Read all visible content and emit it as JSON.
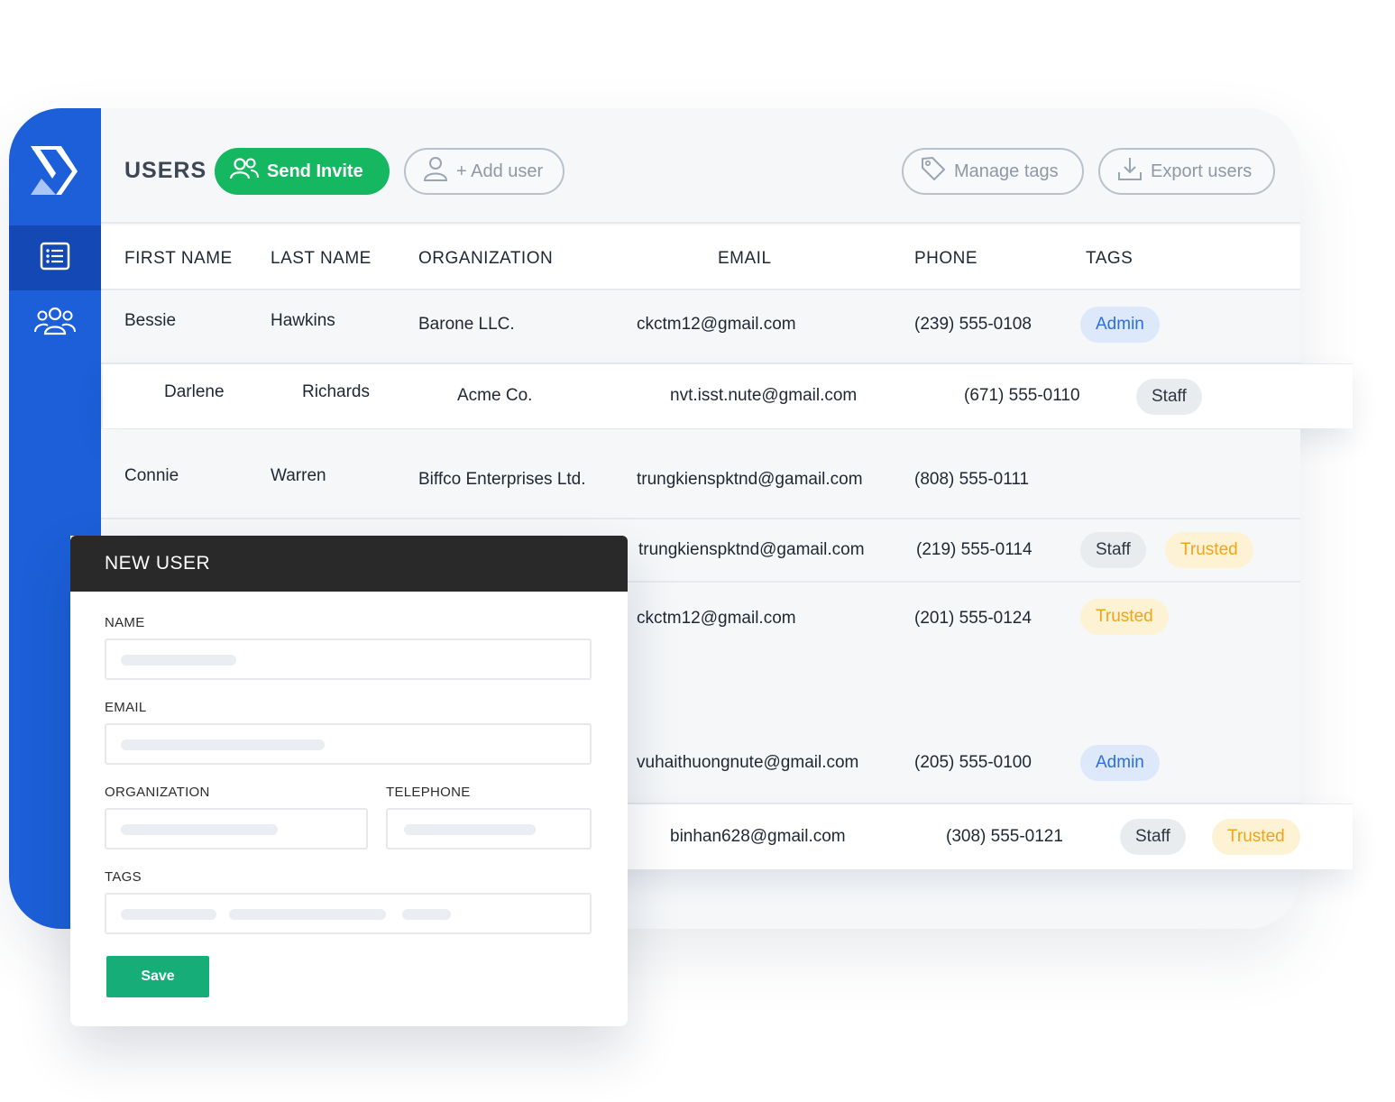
{
  "toolbar": {
    "title": "USERS",
    "send_invite": "Send Invite",
    "add_user": "+ Add user",
    "manage_tags": "Manage tags",
    "export_users": "Export users"
  },
  "table": {
    "columns": [
      "FIRST NAME",
      "LAST NAME",
      "ORGANIZATION",
      "EMAIL",
      "PHONE",
      "TAGS"
    ],
    "rows": [
      {
        "first": "Bessie",
        "last": "Hawkins",
        "org": "Barone LLC.",
        "email": "ckctm12@gmail.com",
        "phone": "(239) 555-0108",
        "tags": [
          "Admin"
        ]
      },
      {
        "first": "Darlene",
        "last": "Richards",
        "org": "Acme Co.",
        "email": "nvt.isst.nute@gmail.com",
        "phone": "(671) 555-0110",
        "tags": [
          "Staff"
        ]
      },
      {
        "first": "Connie",
        "last": "Warren",
        "org": "Biffco Enterprises Ltd.",
        "email": "trungkienspktnd@gamail.com",
        "phone": "(808) 555-0111",
        "tags": []
      },
      {
        "first": "",
        "last": "",
        "org": "",
        "email": "trungkienspktnd@gamail.com",
        "phone": "(219) 555-0114",
        "tags": [
          "Staff",
          "Trusted"
        ]
      },
      {
        "first": "",
        "last": "",
        "org": "",
        "email": "ckctm12@gmail.com",
        "phone": "(201) 555-0124",
        "tags": [
          "Trusted"
        ]
      },
      {
        "first": "",
        "last": "",
        "org": "",
        "email": "vuhaithuongnute@gmail.com",
        "phone": "(205) 555-0100",
        "tags": [
          "Admin"
        ]
      },
      {
        "first": "",
        "last": "",
        "org": "",
        "email": "binhan628@gmail.com",
        "phone": "(308) 555-0121",
        "tags": [
          "Staff",
          "Trusted"
        ]
      }
    ]
  },
  "modal": {
    "title": "NEW USER",
    "name_label": "NAME",
    "email_label": "EMAIL",
    "organization_label": "ORGANIZATION",
    "telephone_label": "TELEPHONE",
    "tags_label": "TAGS",
    "save_label": "Save"
  },
  "colors": {
    "sidebar": "#1c5fd8",
    "sidebar_active": "#1448b4",
    "invite_button": "#15b861",
    "save_button": "#16ad79",
    "modal_header": "#292929",
    "admin_tag_bg": "#dde8fb",
    "admin_tag_text": "#2b6fe0",
    "staff_tag_bg": "#e9ecef",
    "trusted_tag_bg": "#fdf2d3",
    "trusted_tag_text": "#f0a418"
  },
  "icons": {
    "logo": "app-logo",
    "nav": [
      "list-icon",
      "users-icon"
    ],
    "send_invite": "users-icon",
    "add_user": "user-icon",
    "manage_tags": "tag-icon",
    "export_users": "download-icon"
  }
}
